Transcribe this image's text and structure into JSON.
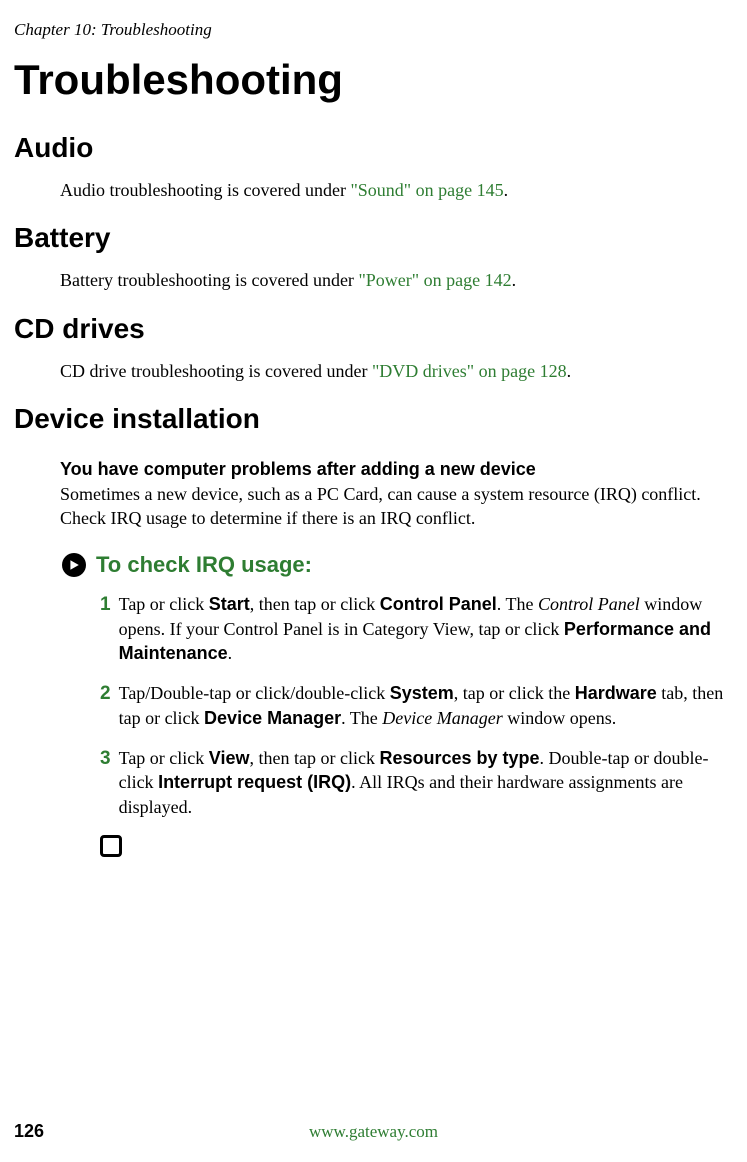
{
  "header": {
    "chapter": "Chapter 10: Troubleshooting"
  },
  "title": "Troubleshooting",
  "sections": {
    "audio": {
      "heading": "Audio",
      "text_pre": "Audio troubleshooting is covered under ",
      "link": "\"Sound\" on page 145",
      "text_post": "."
    },
    "battery": {
      "heading": "Battery",
      "text_pre": "Battery troubleshooting is covered under ",
      "link": "\"Power\" on page 142",
      "text_post": "."
    },
    "cd": {
      "heading": "CD drives",
      "text_pre": "CD drive troubleshooting is covered under ",
      "link": "\"DVD drives\" on page 128",
      "text_post": "."
    },
    "device": {
      "heading": "Device installation",
      "problem": "You have computer problems after adding a new device",
      "desc": "Sometimes a new device, such as a PC Card, can cause a system resource (IRQ) conflict. Check IRQ usage to determine if there is an IRQ conflict.",
      "procedure_title": "To check IRQ usage:",
      "steps": {
        "s1": {
          "num": "1",
          "t1": "Tap or click ",
          "b1": "Start",
          "t2": ", then tap or click ",
          "b2": "Control Panel",
          "t3": ". The ",
          "i1": "Control Panel",
          "t4": " window opens. If your Control Panel is in Category View, tap or click ",
          "b3": "Performance and Maintenance",
          "t5": "."
        },
        "s2": {
          "num": "2",
          "t1": "Tap/Double-tap or click/double-click ",
          "b1": "System",
          "t2": ", tap or click the ",
          "b2": "Hardware",
          "t3": " tab, then tap or click ",
          "b3": "Device Manager",
          "t4": ". The ",
          "i1": "Device Manager",
          "t5": " window opens."
        },
        "s3": {
          "num": "3",
          "t1": "Tap or click ",
          "b1": "View",
          "t2": ", then tap or click ",
          "b2": "Resources by type",
          "t3": ". Double-tap or double-click ",
          "b3": "Interrupt request (IRQ)",
          "t4": ". All IRQs and their hardware assignments are displayed."
        }
      }
    }
  },
  "footer": {
    "page": "126",
    "url": "www.gateway.com"
  }
}
